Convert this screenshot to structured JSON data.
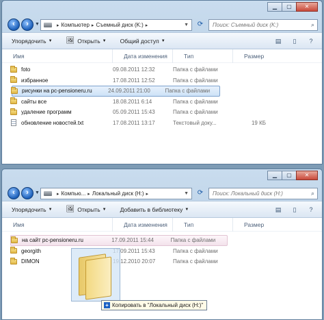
{
  "window1": {
    "address": {
      "segments": [
        "Компьютер",
        "Съемный диск (K:)"
      ]
    },
    "search": {
      "placeholder": "Поиск: Съемный диск (K:)"
    },
    "toolbar": {
      "organize": "Упорядочить",
      "open": "Открыть",
      "share": "Общий доступ"
    },
    "columns": {
      "name": "Имя",
      "date": "Дата изменения",
      "type": "Тип",
      "size": "Размер"
    },
    "files": [
      {
        "name": "foto",
        "date": "09.08.2011 12:32",
        "type": "Папка с файлами",
        "size": "",
        "icon": "folder-icon"
      },
      {
        "name": "избранное",
        "date": "17.08.2011 12:52",
        "type": "Папка с файлами",
        "size": "",
        "icon": "folder-icon"
      },
      {
        "name": "рисунки на pc-pensioneru.ru",
        "date": "24.09.2011 21:00",
        "type": "Папка с файлами",
        "size": "",
        "icon": "folder-icon",
        "selected": true
      },
      {
        "name": "сайты все",
        "date": "18.08.2011 6:14",
        "type": "Папка с файлами",
        "size": "",
        "icon": "folder-icon"
      },
      {
        "name": "удаление программ",
        "date": "05.09.2011 15:43",
        "type": "Папка с файлами",
        "size": "",
        "icon": "folder-icon"
      },
      {
        "name": "обновление новостей.txt",
        "date": "17.08.2011 13:17",
        "type": "Текстовый доку...",
        "size": "19 КБ",
        "icon": "text-file-icon"
      }
    ]
  },
  "window2": {
    "address": {
      "segments": [
        "Компью...",
        "Локальный диск (H:)"
      ]
    },
    "search": {
      "placeholder": "Поиск: Локальный диск (H:)"
    },
    "toolbar": {
      "organize": "Упорядочить",
      "open": "Открыть",
      "library": "Добавить в библиотеку"
    },
    "columns": {
      "name": "Имя",
      "date": "Дата изменения",
      "type": "Тип",
      "size": "Размер"
    },
    "files": [
      {
        "name": "на сайт pc-pensioneru.ru",
        "date": "17.09.2011 15:44",
        "type": "Папка с файлами",
        "size": "",
        "icon": "folder-icon",
        "highlighted": true
      },
      {
        "name": "georgith",
        "date": "17.09.2011 15:43",
        "type": "Папка с файлами",
        "size": "",
        "icon": "folder-icon"
      },
      {
        "name": "DIMON",
        "date": "19.12.2010 20:07",
        "type": "Папка с файлами",
        "size": "",
        "icon": "folder-icon"
      }
    ]
  },
  "drag": {
    "tooltip": "Копировать в \"Локальный диск (H:)\""
  }
}
